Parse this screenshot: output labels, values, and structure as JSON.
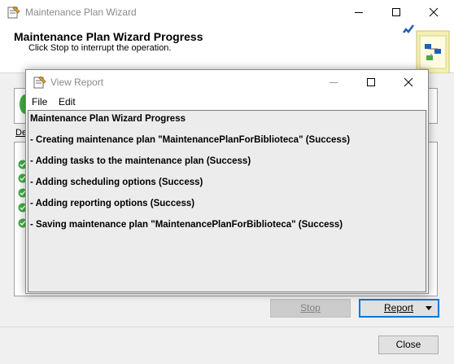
{
  "wizard": {
    "window_title": "Maintenance Plan Wizard",
    "heading": "Maintenance Plan Wizard Progress",
    "subheading": "Click Stop to interrupt the operation.",
    "details_label": "De",
    "buttons": {
      "stop": "Stop",
      "report": "Report",
      "close": "Close"
    }
  },
  "report_window": {
    "title": "View Report",
    "menu": [
      "File",
      "Edit"
    ],
    "lines": [
      "Maintenance Plan Wizard Progress",
      "- Creating maintenance plan \"MaintenancePlanForBiblioteca\" (Success)",
      "- Adding tasks to the maintenance plan (Success)",
      "- Adding scheduling options (Success)",
      "- Adding reporting options (Success)",
      "- Saving maintenance plan \"MaintenancePlanForBiblioteca\" (Success)"
    ]
  },
  "icons": {
    "app": "wizard-app-icon",
    "success": "success-check-icon",
    "header_graphic": "wizard-checklist-graphic"
  },
  "colors": {
    "accent": "#0078d7",
    "success": "#3fae3f",
    "window_bg": "#f0f0f0"
  }
}
